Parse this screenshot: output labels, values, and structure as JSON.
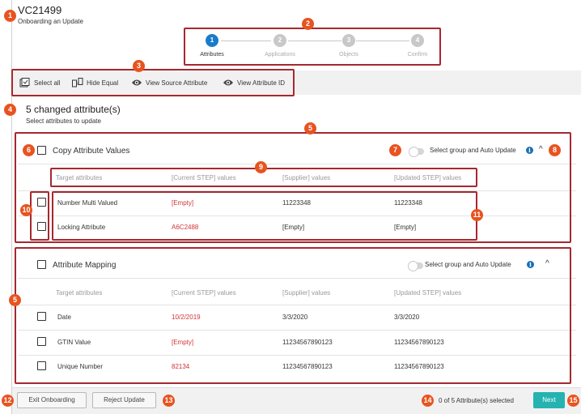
{
  "header": {
    "id": "VC21499",
    "subtitle": "Onboarding an Update"
  },
  "stepper": {
    "steps": [
      {
        "number": "1",
        "label": "Attributes",
        "active": true
      },
      {
        "number": "2",
        "label": "Applications",
        "active": false
      },
      {
        "number": "3",
        "label": "Objects",
        "active": false
      },
      {
        "number": "4",
        "label": "Confirm",
        "active": false
      }
    ]
  },
  "toolbar": {
    "select_all": "Select all",
    "hide_equal": "Hide Equal",
    "view_source": "View Source Attribute",
    "view_id": "View Attribute ID"
  },
  "summary": {
    "title": "5 changed attribute(s)",
    "subtitle": "Select attributes to update"
  },
  "columns": [
    "Target attributes",
    "[Current STEP] values",
    "[Supplier] values",
    "[Updated STEP] values"
  ],
  "groups": [
    {
      "title": "Copy Attribute Values",
      "auto_label": "Select group and Auto Update",
      "rows": [
        {
          "target": "Number Multi Valued",
          "current": "[Empty]",
          "supplier": "11223348",
          "updated": "11223348"
        },
        {
          "target": "Locking Attribute",
          "current": "A6C2488",
          "supplier": "[Empty]",
          "updated": "[Empty]"
        }
      ]
    },
    {
      "title": "Attribute Mapping",
      "auto_label": "Select group and Auto Update",
      "rows": [
        {
          "target": "Date",
          "current": "10/2/2019",
          "supplier": "3/3/2020",
          "updated": "3/3/2020"
        },
        {
          "target": "GTIN Value",
          "current": "[Empty]",
          "supplier": "11234567890123",
          "updated": "11234567890123"
        },
        {
          "target": "Unique Number",
          "current": "82134",
          "supplier": "11234567890123",
          "updated": "11234567890123"
        }
      ]
    }
  ],
  "footer": {
    "exit_label": "Exit Onboarding",
    "reject_label": "Reject Update",
    "selection_status": "0 of 5 Attribute(s) selected",
    "next_label": "Next"
  },
  "callouts": [
    "1",
    "2",
    "3",
    "4",
    "5",
    "6",
    "7",
    "8",
    "9",
    "10",
    "11",
    "12",
    "13",
    "14",
    "15",
    "5"
  ],
  "colors": {
    "accent": "#1a7cc9",
    "callout": "#e8531f",
    "highlight_box": "#a6282f",
    "changed_value": "#d13438",
    "next_button": "#24b3b1"
  }
}
